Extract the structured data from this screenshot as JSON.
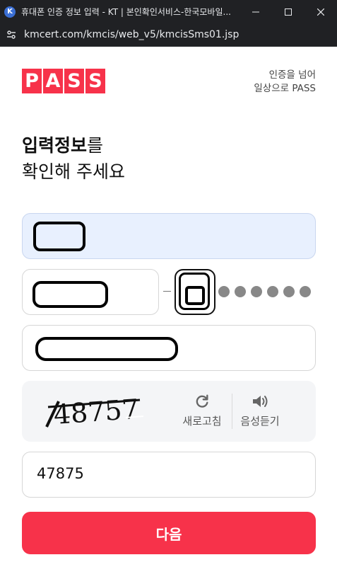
{
  "window": {
    "title": "휴대폰 인증 정보 입력 - KT | 본인확인서비스-한국모바일...",
    "favicon_letter": "K"
  },
  "address_bar": {
    "url": "kmcert.com/kmcis/web_v5/kmcisSms01.jsp"
  },
  "brand": {
    "logo_letters": [
      "P",
      "A",
      "S",
      "S"
    ],
    "slogan_line1": "인증을 넘어",
    "slogan_line2": "일상으로 PASS",
    "accent_color": "#f7324a"
  },
  "heading": {
    "bold": "입력정보",
    "rest": "를",
    "line2": "확인해 주세요"
  },
  "form": {
    "name_field": {
      "value_redacted": true
    },
    "birth_field": {
      "value_redacted": true
    },
    "gender_field": {
      "value_redacted": true,
      "masked_digit_count": 6
    },
    "phone_field": {
      "value_redacted": true
    }
  },
  "captcha": {
    "image_text": "48757",
    "refresh_label": "새로고침",
    "audio_label": "음성듣기"
  },
  "captcha_input": {
    "value": "47875"
  },
  "next_button": {
    "label": "다음"
  }
}
